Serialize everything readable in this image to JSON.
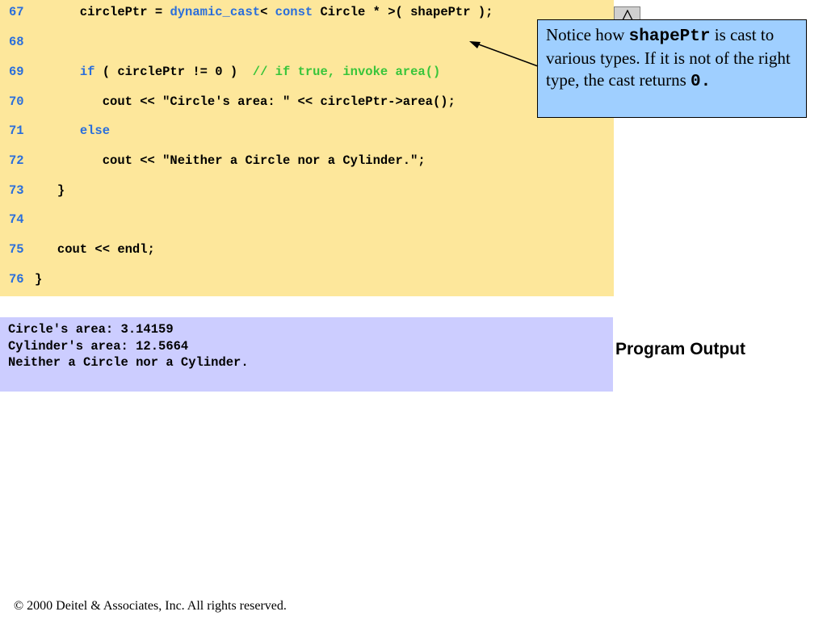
{
  "code": {
    "lines": [
      {
        "num": "67",
        "tokens": [
          {
            "t": "      circlePtr = "
          },
          {
            "t": "dynamic_cast",
            "c": "kw"
          },
          {
            "t": "< "
          },
          {
            "t": "const",
            "c": "kw"
          },
          {
            "t": " Circle * >( shapePtr );"
          }
        ]
      },
      {
        "num": "68",
        "tokens": []
      },
      {
        "num": "69",
        "tokens": [
          {
            "t": "      "
          },
          {
            "t": "if",
            "c": "kw"
          },
          {
            "t": " ( circlePtr != 0 )  "
          },
          {
            "t": "// if true, invoke area()",
            "c": "cm"
          }
        ]
      },
      {
        "num": "70",
        "tokens": [
          {
            "t": "         cout << \"Circle's area: \" << circlePtr->area();"
          }
        ]
      },
      {
        "num": "71",
        "tokens": [
          {
            "t": "      "
          },
          {
            "t": "else",
            "c": "kw"
          }
        ]
      },
      {
        "num": "72",
        "tokens": [
          {
            "t": "         cout << \"Neither a Circle nor a Cylinder.\";"
          }
        ]
      },
      {
        "num": "73",
        "tokens": [
          {
            "t": "   }"
          }
        ]
      },
      {
        "num": "74",
        "tokens": []
      },
      {
        "num": "75",
        "tokens": [
          {
            "t": "   cout << endl;"
          }
        ]
      },
      {
        "num": "76",
        "tokens": [
          {
            "t": "}"
          }
        ]
      }
    ]
  },
  "callout": {
    "before": "Notice how ",
    "code": "shapePtr",
    "middle": " is cast to various types.  If it is not of the right type, the cast returns ",
    "code2": "0."
  },
  "output": {
    "lines": [
      "Circle's area: 3.14159",
      "Cylinder's area: 12.5664",
      "Neither a Circle nor a Cylinder."
    ],
    "label": "Program Output"
  },
  "footer": {
    "copyright": "© 2000 Deitel & Associates, Inc.  All rights reserved."
  },
  "colors": {
    "code_bg": "#fde79b",
    "output_bg": "#cccdff",
    "callout_bg": "#9fcfff",
    "keyword": "#2a6edb",
    "comment": "#39c53a"
  }
}
